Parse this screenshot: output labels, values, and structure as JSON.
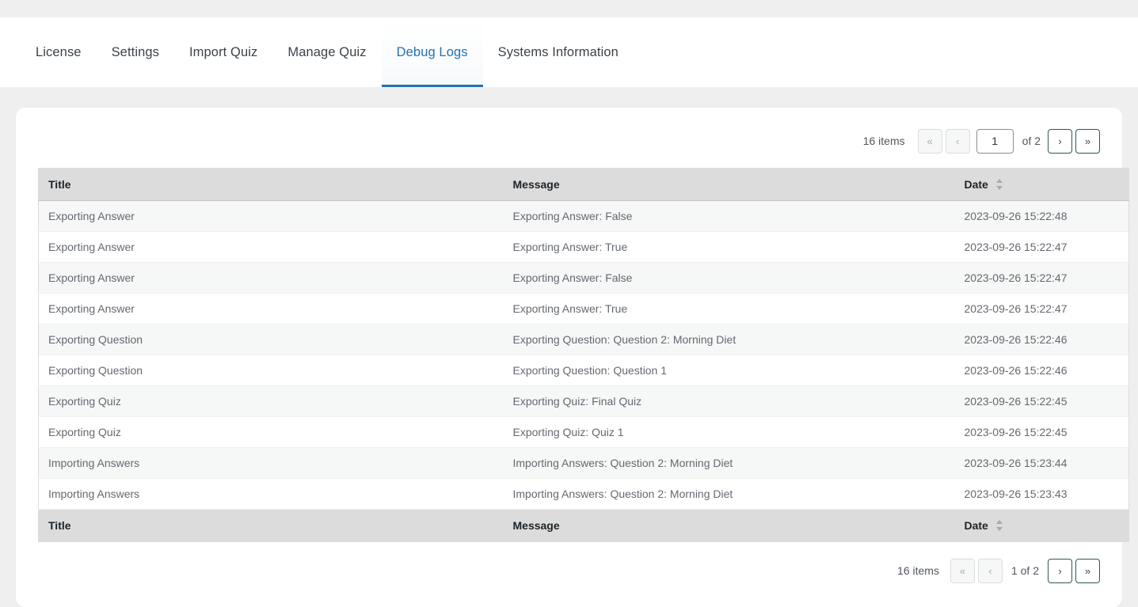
{
  "nav": {
    "tabs": [
      {
        "label": "License",
        "active": false
      },
      {
        "label": "Settings",
        "active": false
      },
      {
        "label": "Import Quiz",
        "active": false
      },
      {
        "label": "Manage Quiz",
        "active": false
      },
      {
        "label": "Debug Logs",
        "active": true
      },
      {
        "label": "Systems Information",
        "active": false
      }
    ]
  },
  "pagination_top": {
    "items_label": "16 items",
    "first_label": "«",
    "prev_label": "‹",
    "current_page": "1",
    "of_label": "of 2",
    "next_label": "›",
    "last_label": "»"
  },
  "pagination_bottom": {
    "items_label": "16 items",
    "first_label": "«",
    "prev_label": "‹",
    "paging_label": "1 of 2",
    "next_label": "›",
    "last_label": "»"
  },
  "table": {
    "columns": {
      "title": "Title",
      "message": "Message",
      "date": "Date"
    },
    "rows": [
      {
        "title": "Exporting Answer",
        "message": "Exporting Answer: False",
        "date": "2023-09-26 15:22:48"
      },
      {
        "title": "Exporting Answer",
        "message": "Exporting Answer: True",
        "date": "2023-09-26 15:22:47"
      },
      {
        "title": "Exporting Answer",
        "message": "Exporting Answer: False",
        "date": "2023-09-26 15:22:47"
      },
      {
        "title": "Exporting Answer",
        "message": "Exporting Answer: True",
        "date": "2023-09-26 15:22:47"
      },
      {
        "title": "Exporting Question",
        "message": "Exporting Question: Question 2: Morning Diet",
        "date": "2023-09-26 15:22:46"
      },
      {
        "title": "Exporting Question",
        "message": "Exporting Question: Question 1",
        "date": "2023-09-26 15:22:46"
      },
      {
        "title": "Exporting Quiz",
        "message": "Exporting Quiz: Final Quiz",
        "date": "2023-09-26 15:22:45"
      },
      {
        "title": "Exporting Quiz",
        "message": "Exporting Quiz: Quiz 1",
        "date": "2023-09-26 15:22:45"
      },
      {
        "title": "Importing Answers",
        "message": "Importing Answers: Question 2: Morning Diet",
        "date": "2023-09-26 15:23:44"
      },
      {
        "title": "Importing Answers",
        "message": "Importing Answers: Question 2: Morning Diet",
        "date": "2023-09-26 15:23:43"
      }
    ]
  },
  "colors": {
    "accent": "#2271b1",
    "page_bg": "#efefef",
    "card_bg": "#ffffff",
    "header_bg": "#dcdcdc",
    "row_alt_bg": "#f6f7f7",
    "enabled_btn_border": "#2c5858"
  }
}
